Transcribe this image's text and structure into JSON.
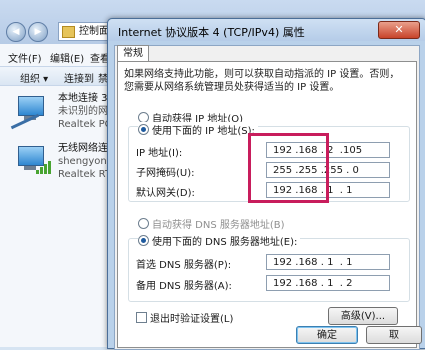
{
  "explorer": {
    "address": "控制面",
    "back_arrow": "◀",
    "forward_arrow": "▶",
    "menu": [
      "文件(F)",
      "编辑(E)",
      "查看"
    ],
    "toolbar": [
      "组织 ▾",
      "连接到",
      "禁"
    ],
    "connections": [
      {
        "name": "本地连接 3",
        "status": "未识别的网",
        "adapter": "Realtek PC",
        "icon": "ethernet-adapter-icon"
      },
      {
        "name": "无线网络连",
        "status": "shengyong",
        "adapter": "Realtek RT",
        "icon": "wireless-adapter-icon"
      }
    ]
  },
  "dialog": {
    "title": "Internet 协议版本 4 (TCP/IPv4) 属性",
    "close_glyph": "✕",
    "tab": "常规",
    "intro": "如果网络支持此功能，则可以获取自动指派的 IP 设置。否则，您需要从网络系统管理员处获得适当的 IP 设置。",
    "ip_auto": "自动获得 IP 地址(O)",
    "ip_manual": "使用下面的 IP 地址(S):",
    "ip_address_label": "IP 地址(I):",
    "ip_address": "192 .168 . 2  .105",
    "subnet_label": "子网掩码(U):",
    "subnet": "255 .255 .255 . 0",
    "gateway_label": "默认网关(D):",
    "gateway": "192 .168 . 1  . 1",
    "dns_auto": "自动获得 DNS 服务器地址(B)",
    "dns_manual": "使用下面的 DNS 服务器地址(E):",
    "dns_pref_label": "首选 DNS 服务器(P):",
    "dns_pref": "192 .168 . 1  . 1",
    "dns_alt_label": "备用 DNS 服务器(A):",
    "dns_alt": "192 .168 . 1  . 2",
    "validate_label": "退出时验证设置(L)",
    "advanced_btn": "高级(V)...",
    "ok_btn": "确定",
    "cancel_btn": "取"
  },
  "colors": {
    "highlight": "#c81d5c",
    "accent": "#1e5a9e"
  }
}
